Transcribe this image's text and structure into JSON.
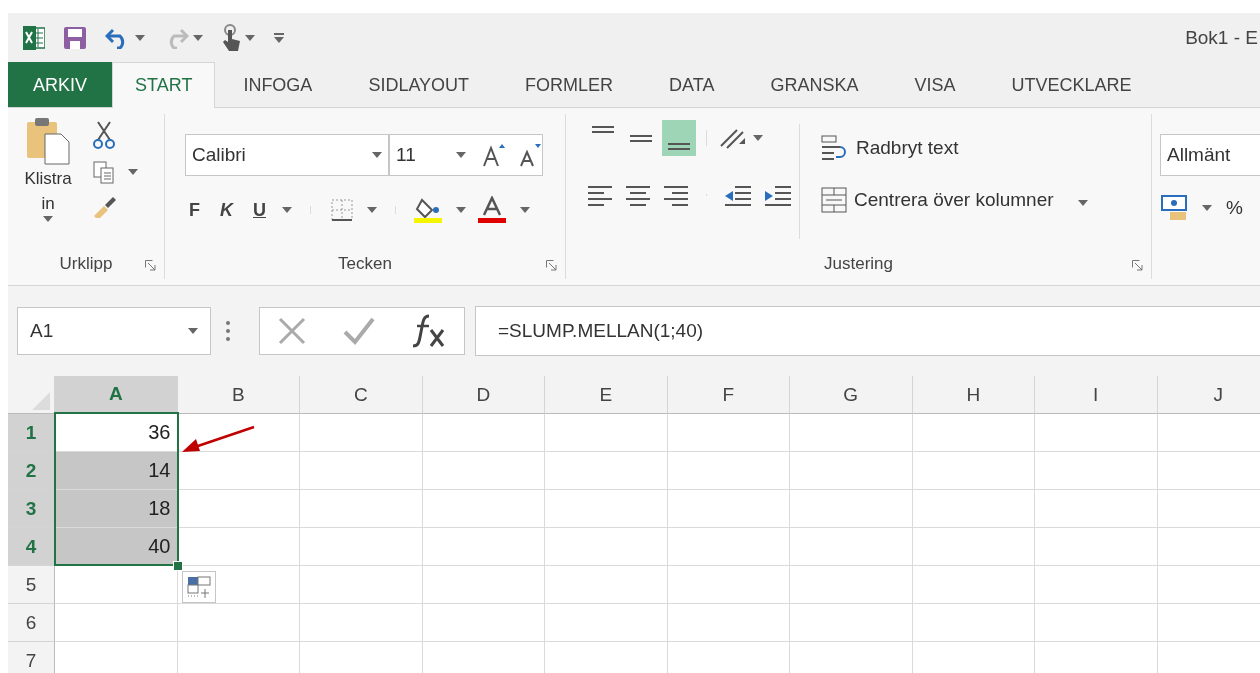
{
  "window": {
    "title": "Bok1 - E"
  },
  "tabs": [
    {
      "label": "ARKIV",
      "kind": "file",
      "selected": false
    },
    {
      "label": "START",
      "kind": "tab",
      "selected": true
    },
    {
      "label": "INFOGA",
      "kind": "tab",
      "selected": false
    },
    {
      "label": "SIDLAYOUT",
      "kind": "tab",
      "selected": false
    },
    {
      "label": "FORMLER",
      "kind": "tab",
      "selected": false
    },
    {
      "label": "DATA",
      "kind": "tab",
      "selected": false
    },
    {
      "label": "GRANSKA",
      "kind": "tab",
      "selected": false
    },
    {
      "label": "VISA",
      "kind": "tab",
      "selected": false
    },
    {
      "label": "UTVECKLARE",
      "kind": "tab",
      "selected": false
    }
  ],
  "ribbon": {
    "clipboard": {
      "label": "Urklipp",
      "paste": "Klistra in"
    },
    "font": {
      "label": "Tecken",
      "font_name": "Calibri",
      "font_size": "11",
      "bold": "F",
      "italic": "K",
      "underline": "U"
    },
    "alignment": {
      "label": "Justering",
      "vertical_align": [
        {
          "selected": false
        },
        {
          "selected": false
        },
        {
          "selected": true
        }
      ],
      "wrap_text": "Radbryt text",
      "merge_center": "Centrera över kolumner"
    },
    "number": {
      "format": "Allmänt",
      "percent": "%"
    }
  },
  "formula_bar": {
    "name_box": "A1",
    "formula": "=SLUMP.MELLAN(1;40)"
  },
  "sheet": {
    "columns": [
      {
        "label": "A",
        "selected": true
      },
      {
        "label": "B",
        "selected": false
      },
      {
        "label": "C",
        "selected": false
      },
      {
        "label": "D",
        "selected": false
      },
      {
        "label": "E",
        "selected": false
      },
      {
        "label": "F",
        "selected": false
      },
      {
        "label": "G",
        "selected": false
      },
      {
        "label": "H",
        "selected": false
      },
      {
        "label": "I",
        "selected": false
      },
      {
        "label": "J",
        "selected": false
      }
    ],
    "rows": [
      {
        "label": "1",
        "selected": true,
        "cells": [
          {
            "text": "36",
            "selected": true,
            "active": true
          }
        ]
      },
      {
        "label": "2",
        "selected": true,
        "cells": [
          {
            "text": "14",
            "selected": true,
            "active": false
          }
        ]
      },
      {
        "label": "3",
        "selected": true,
        "cells": [
          {
            "text": "18",
            "selected": true,
            "active": false
          }
        ]
      },
      {
        "label": "4",
        "selected": true,
        "cells": [
          {
            "text": "40",
            "selected": true,
            "active": false
          }
        ]
      },
      {
        "label": "5",
        "selected": false
      },
      {
        "label": "6",
        "selected": false
      },
      {
        "label": "7",
        "selected": false
      }
    ]
  }
}
